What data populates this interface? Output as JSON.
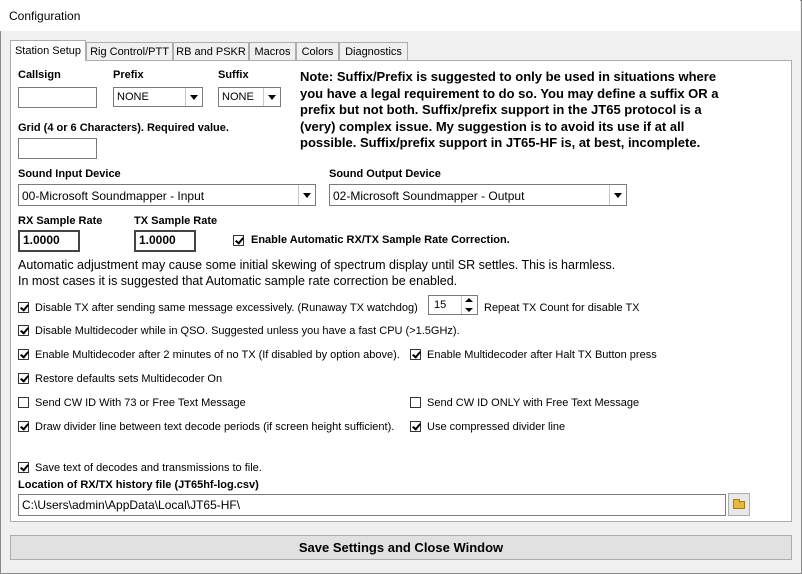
{
  "window": {
    "title": "Configuration"
  },
  "tabs": [
    "Station Setup",
    "Rig Control/PTT",
    "RB and PSKR",
    "Macros",
    "Colors",
    "Diagnostics"
  ],
  "station": {
    "callsign_label": "Callsign",
    "callsign_value": "",
    "prefix_label": "Prefix",
    "prefix_value": "NONE",
    "suffix_label": "Suffix",
    "suffix_value": "NONE",
    "grid_label": "Grid (4 or 6 Characters).  Required value.",
    "grid_value": "",
    "note": "Note:  Suffix/Prefix is suggested to only be used in situations where you have a legal requirement to do so.  You may define a suffix OR a prefix but not both.  Suffix/prefix support in the JT65 protocol is a (very) complex issue.  My suggestion is to avoid its use if at all possible.  Suffix/prefix support in JT65-HF is, at best, incomplete."
  },
  "sound": {
    "input_label": "Sound Input Device",
    "input_value": "00-Microsoft Soundmapper - Input",
    "output_label": "Sound Output Device",
    "output_value": "02-Microsoft Soundmapper - Output",
    "rx_rate_label": "RX Sample Rate",
    "rx_rate_value": "1.0000",
    "tx_rate_label": "TX Sample Rate",
    "tx_rate_value": "1.0000",
    "auto_correction_label": "Enable Automatic RX/TX Sample Rate Correction.",
    "auto_para_1": "Automatic adjustment may cause some initial skewing of spectrum display until SR settles.  This is harmless.",
    "auto_para_2": "In most cases it is suggested that Automatic sample rate correction be enabled."
  },
  "options": {
    "runaway_label": "Disable TX after sending same message excessively. (Runaway TX watchdog)",
    "repeat_count_value": "15",
    "repeat_count_label": "Repeat TX Count for disable TX",
    "multidecoder_qso_label": "Disable Multidecoder while in QSO.  Suggested unless you have a fast CPU (>1.5GHz).",
    "multidecoder_2min_label": "Enable Multidecoder after 2 minutes of no TX (If disabled by option above).",
    "multidecoder_halt_label": "Enable Multidecoder after Halt TX Button press",
    "restore_defaults_label": "Restore defaults sets Multidecoder On",
    "cw_id_73_label": "Send CW ID With 73 or Free Text Message",
    "cw_id_only_label": "Send CW ID ONLY with Free Text Message",
    "divider_line_label": "Draw divider line between text decode periods (if screen height sufficient).",
    "compressed_divider_label": "Use compressed divider line",
    "save_text_label": "Save text of decodes and transmissions to file.",
    "history_label": "Location of RX/TX history file (JT65hf-log.csv)",
    "history_path": "C:\\Users\\admin\\AppData\\Local\\JT65-HF\\"
  },
  "footer": {
    "save_label": "Save Settings and Close Window"
  }
}
